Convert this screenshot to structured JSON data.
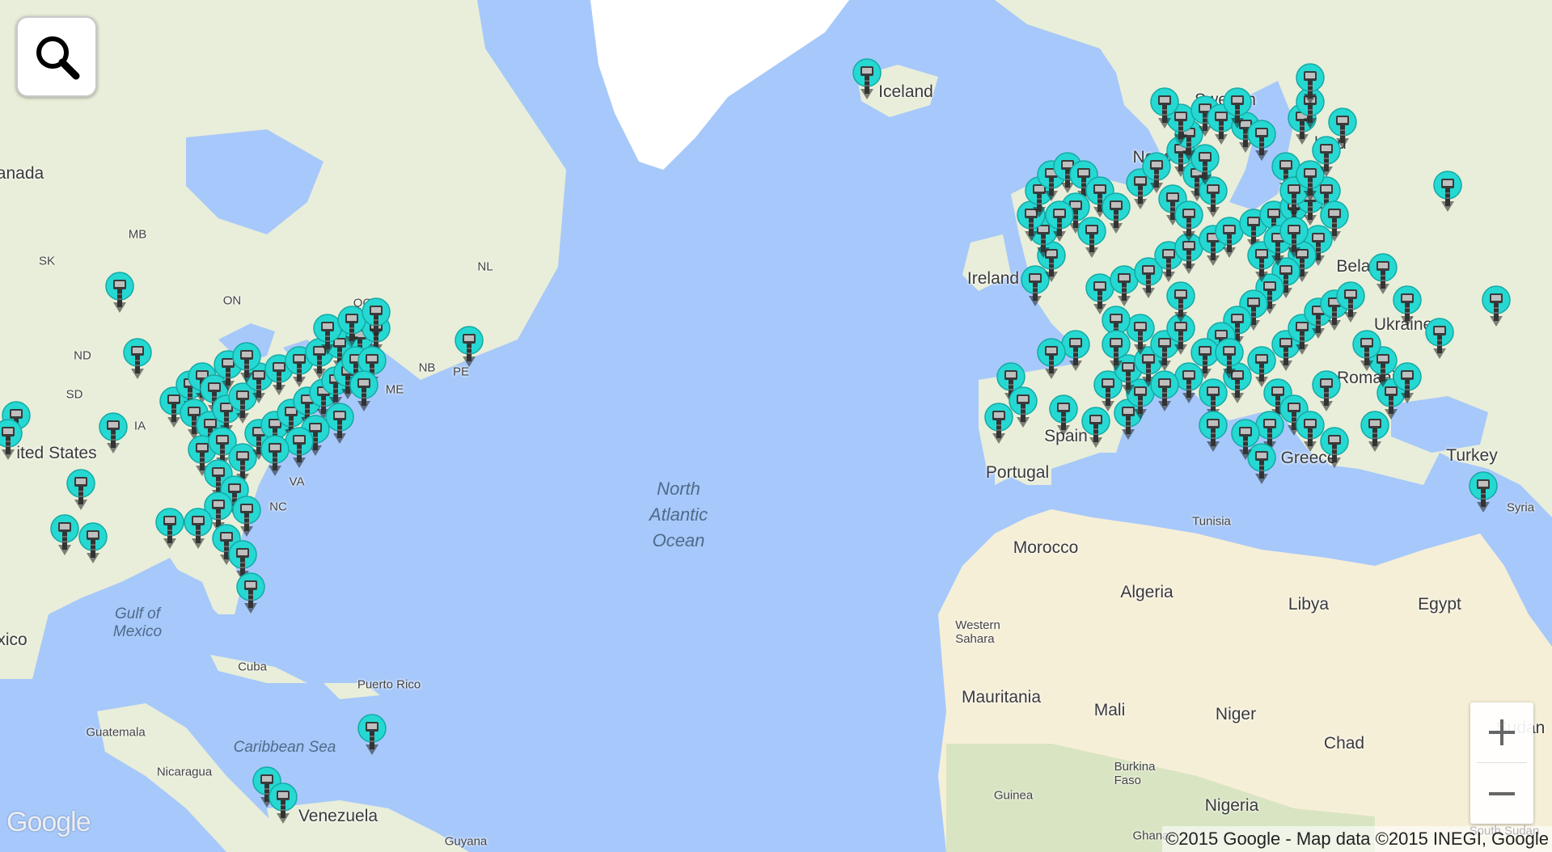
{
  "map": {
    "ocean_color": "#a7c8fa",
    "land_color": "#e8eed9",
    "ice_color": "#ffffff",
    "desert_color": "#f6efd7",
    "forest_color": "#cfe1bb",
    "pin_color": "#26d8d2",
    "labels": {
      "iceland": "Iceland",
      "sweden": "Sweden",
      "norway": "Norw",
      "finland": "land",
      "canada": "anada",
      "mb": "MB",
      "sk": "SK",
      "on": "ON",
      "nl": "NL",
      "qc": "QC",
      "nb": "NB",
      "pe": "PE",
      "me": "ME",
      "nd": "ND",
      "sd": "SD",
      "ia": "IA",
      "nc": "NC",
      "va": "VA",
      "united_states": "ited States",
      "ireland": "Ireland",
      "belarus": "Belarus",
      "ukraine": "Ukraine",
      "romania": "Romania",
      "portugal": "Portugal",
      "spain": "Spain",
      "greece": "Greece",
      "turkey": "Turkey",
      "syria": "Syria",
      "tunisia": "Tunisia",
      "morocco": "Morocco",
      "algeria": "Algeria",
      "libya": "Libya",
      "egypt": "Egypt",
      "western_sahara": "Western\nSahara",
      "mauritania": "Mauritania",
      "mali": "Mali",
      "niger": "Niger",
      "chad": "Chad",
      "sudan": "Sudan",
      "burkina_faso": "Burkina\nFaso",
      "guinea": "Guinea",
      "nigeria": "Nigeria",
      "ghana": "Ghana",
      "south_sudan": "South Sudan",
      "north_atlantic": "North\nAtlantic\nOcean",
      "gulf_of_mexico": "Gulf of\nMexico",
      "mexico": "xico",
      "cuba": "Cuba",
      "puerto_rico": "Puerto Rico",
      "caribbean": "Caribbean Sea",
      "guatemala": "Guatemala",
      "nicaragua": "Nicaragua",
      "venezuela": "Venezuela",
      "guyana": "Guyana"
    }
  },
  "search": {
    "icon": "search-icon"
  },
  "zoom": {
    "in_icon": "plus-icon",
    "out_icon": "minus-icon"
  },
  "logo": "Google",
  "attribution": "©2015 Google - Map data ©2015 INEGI, Google"
}
